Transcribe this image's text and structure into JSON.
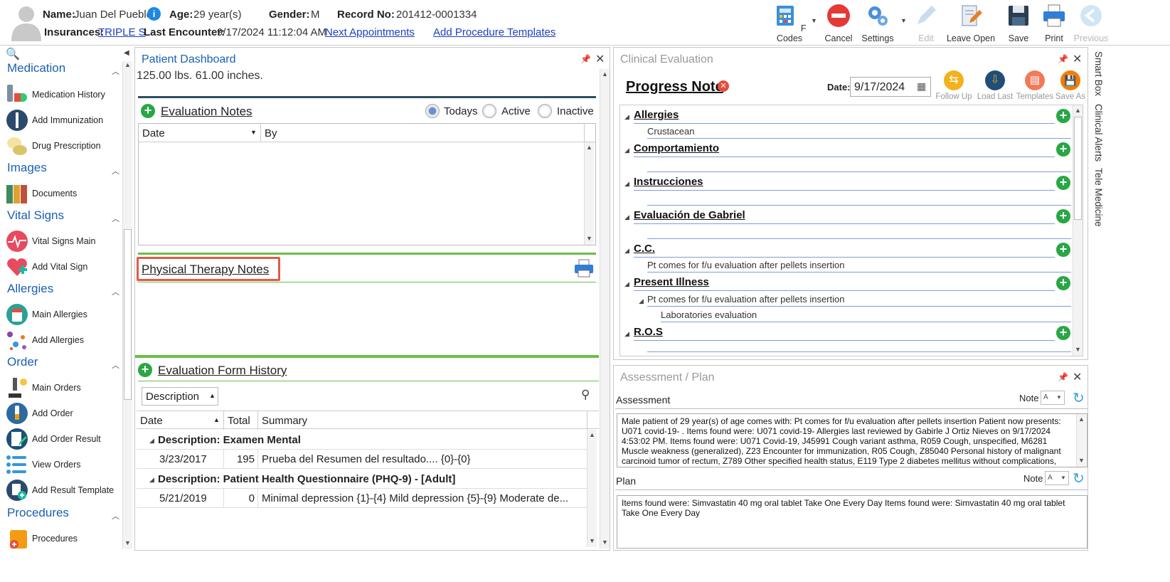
{
  "patient": {
    "name_label": "Name:",
    "name": "Juan Del Pueblo",
    "age_label": "Age:",
    "age": "29 year(s)",
    "gender_label": "Gender:",
    "gender": "M",
    "record_label": "Record No:",
    "record_no": "201412-0001334",
    "insurances_label": "Insurances:",
    "insurance": "TRIPLE S",
    "last_encounter_label": "Last Encounter:",
    "last_encounter": "9/17/2024 11:12:04 AM",
    "next_appointments": "Next Appointments",
    "add_procedure_templates": "Add Procedure Templates"
  },
  "toolbar": {
    "fcodes": "F Codes",
    "cancel": "Cancel",
    "settings": "Settings",
    "edit": "Edit",
    "leave_open": "Leave Open",
    "save": "Save",
    "print": "Print",
    "previous": "Previous"
  },
  "sidebar": {
    "sections": [
      {
        "title": "Medication",
        "items": [
          "Medication History",
          "Add Immunization",
          "Drug Prescription"
        ]
      },
      {
        "title": "Images",
        "items": [
          "Documents"
        ]
      },
      {
        "title": "Vital Signs",
        "items": [
          "Vital Signs Main",
          "Add Vital Sign"
        ]
      },
      {
        "title": "Allergies",
        "items": [
          "Main Allergies",
          "Add Allergies"
        ]
      },
      {
        "title": "Order",
        "items": [
          "Main Orders",
          "Add Order",
          "Add Order Result",
          "View Orders",
          "Add Result Template"
        ]
      },
      {
        "title": "Procedures",
        "items": [
          "Procedures"
        ]
      }
    ]
  },
  "dashboard": {
    "title": "Patient Dashboard",
    "vitals_text": "125.00 lbs. 61.00 inches.",
    "evaluation_notes": "Evaluation Notes",
    "radio_todays": "Todays",
    "radio_active": "Active",
    "radio_inactive": "Inactive",
    "col_date": "Date",
    "col_by": "By",
    "pt_notes": "Physical Therapy Notes",
    "form_history": "Evaluation Form History",
    "group_by": "Description",
    "hist_cols": {
      "date": "Date",
      "total": "Total",
      "summary": "Summary"
    },
    "groups": [
      {
        "title": "Description: Examen Mental",
        "date": "3/23/2017",
        "total": "195",
        "summary": "Prueba del Resumen del resultado.... {0}-{0}"
      },
      {
        "title": "Description: Patient Health Questionnaire (PHQ-9) - [Adult]",
        "date": "5/21/2019",
        "total": "0",
        "summary": "Minimal depression {1}-{4}  Mild depression {5}-{9}  Moderate de..."
      }
    ]
  },
  "clinical": {
    "title": "Clinical Evaluation",
    "note_title": "Progress Note",
    "date_label": "Date:",
    "date": "9/17/2024",
    "btn_follow_up": "Follow Up",
    "btn_load_last": "Load Last",
    "btn_templates": "Templates",
    "btn_save_as": "Save As",
    "sections": [
      {
        "title": "Allergies",
        "lines": [
          "Crustacean"
        ]
      },
      {
        "title": "Comportamiento",
        "lines": []
      },
      {
        "title": "Instrucciones",
        "lines": []
      },
      {
        "title": "Evaluación de Gabriel",
        "lines": []
      },
      {
        "title": "C.C.",
        "lines": [
          "Pt comes for f/u evaluation after pellets insertion"
        ]
      },
      {
        "title": "Present Illness",
        "sub": "Pt comes for f/u evaluation after pellets insertion",
        "subsub": "Laboratories evaluation"
      },
      {
        "title": "R.O.S",
        "lines": []
      }
    ]
  },
  "assessment": {
    "title": "Assessment / Plan",
    "assessment_label": "Assessment",
    "note_label": "Note",
    "assessment_text": "Male patient of 29 year(s) of age comes with:  Pt comes for f/u evaluation after pellets insertion  Patient now presents: U071 covid-19- . Items found were:  U071 covid-19-    Allergies last reviewed by Gabirle J Ortiz Nieves on 9/17/2024 4:53:02 PM.     Items found were:  U071 Covid-19, J45991 Cough variant asthma, R059 Cough, unspecified, M6281 Muscle weakness (generalized), Z23 Encounter for immunization, R05 Cough, Z85040 Personal history of malignant carcinoid tumor of rectum, Z789 Other specified health status, E119 Type 2 diabetes mellitus without complications,",
    "plan_label": "Plan",
    "plan_text": "  Items found were:  Simvastatin 40 mg oral tablet Take One Every Day   Items found were:  Simvastatin 40 mg oral tablet Take One Every Day"
  },
  "side_tabs": [
    "Smart Box",
    "Clinical Alerts",
    "Tele Medicine"
  ]
}
